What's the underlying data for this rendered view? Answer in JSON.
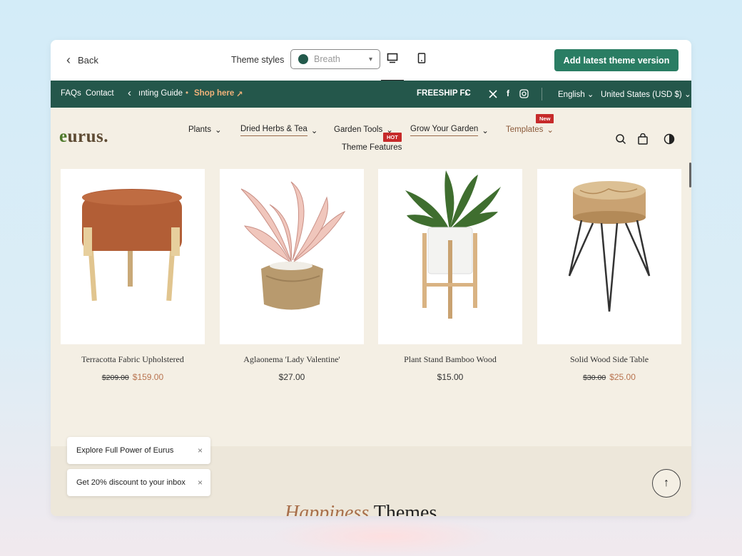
{
  "editor": {
    "back_label": "Back",
    "theme_styles_label": "Theme styles",
    "theme_value": "Breath",
    "add_button": "Add latest theme version"
  },
  "announcement": {
    "faqs": "FAQs",
    "contact": "Contact",
    "guide_text": "ınting Guide",
    "dot": "•",
    "shop_here": "Shop here",
    "shop_arrow": "↗",
    "freeship": "FREESHIP FC",
    "language": "English",
    "currency": "United States (USD $)"
  },
  "header": {
    "logo_e": "e",
    "logo_rest": "urus.",
    "nav": {
      "plants": "Plants",
      "dried": "Dried Herbs & Tea",
      "garden_tools": "Garden Tools",
      "grow": "Grow Your Garden",
      "templates": "Templates",
      "theme_features": "Theme Features"
    },
    "badges": {
      "hot": "HOT",
      "new": "New"
    }
  },
  "products": [
    {
      "name": "Terracotta Fabric Upholstered",
      "old_price": "$209.00",
      "price": "$159.00"
    },
    {
      "name": "Aglaonema 'Lady Valentine'",
      "old_price": "",
      "price": "$27.00"
    },
    {
      "name": "Plant Stand Bamboo Wood",
      "old_price": "",
      "price": "$15.00"
    },
    {
      "name": "Solid Wood Side Table",
      "old_price": "$30.00",
      "price": "$25.00"
    }
  ],
  "toasts": {
    "explore": "Explore Full Power of Eurus",
    "discount": "Get 20% discount to your inbox",
    "close": "×"
  },
  "section": {
    "happiness": "Happiness",
    "themes": " Themes"
  },
  "colors": {
    "brand_green": "#24574b",
    "button_green": "#2a7d63",
    "accent_brown": "#b8734f",
    "badge_red": "#c62a2a"
  }
}
